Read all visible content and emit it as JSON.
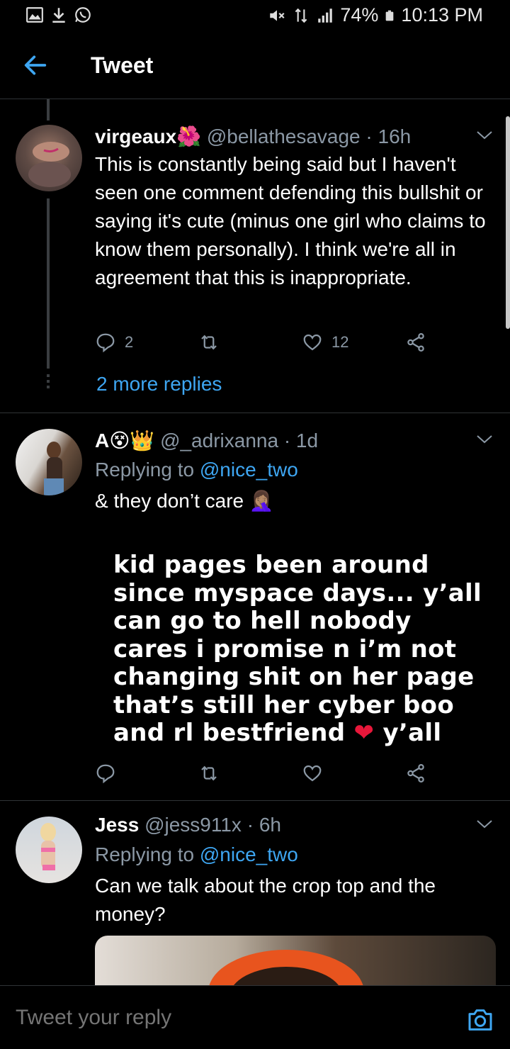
{
  "status_bar": {
    "battery_percent": "74%",
    "time": "10:13 PM"
  },
  "header": {
    "title": "Tweet"
  },
  "tweets": [
    {
      "name": "virgeaux🌺",
      "handle": "@bellathesavage",
      "time": "· 16h",
      "text": "This is constantly being said but I haven't seen one comment defending this bullshit or saying it's cute (minus one girl who claims to know them personally). I think we're all in agreement that this is inappropriate.",
      "reply_count": "2",
      "retweet_count": "",
      "like_count": "12",
      "more_replies": "2 more replies"
    },
    {
      "name": "A😵👑",
      "handle": "@_adrixanna",
      "time": "· 1d",
      "replying_label": "Replying to",
      "replying_to": "@nice_two",
      "text": "& they don’t care 🤦🏽‍♀️",
      "story_text_before_heart": "kid pages been around since myspace days... y’all can go to hell nobody cares i promise n i’m not changing shit on her page that’s still her cyber boo and rl bestfriend",
      "story_heart": "❤",
      "story_text_after_heart": "y’all"
    },
    {
      "name": "Jess",
      "handle": "@jess911x",
      "time": "· 6h",
      "replying_label": "Replying to",
      "replying_to": "@nice_two",
      "text": "Can we talk about the crop top and the money?"
    }
  ],
  "composer": {
    "placeholder": "Tweet your reply"
  },
  "colors": {
    "background": "#000000",
    "accent": "#3ea6f2",
    "muted": "#8b98a5",
    "divider": "#2f3336"
  }
}
